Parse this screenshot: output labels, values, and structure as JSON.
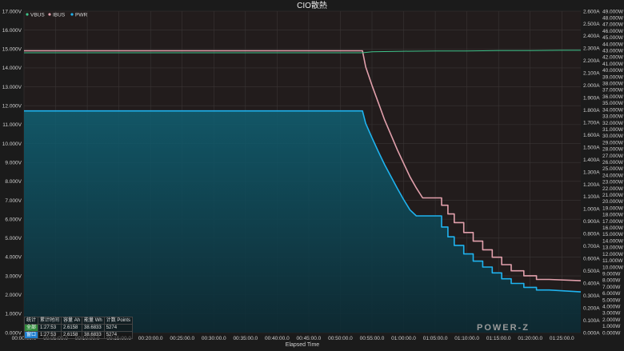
{
  "chart_data": {
    "type": "line",
    "title": "CIO散熱",
    "xlabel": "Elapsed Time",
    "x_ticks": [
      "00:00:00.0",
      "00:05:00.0",
      "00:10:00.0",
      "00:15:00.0",
      "00:20:00.0",
      "00:25:00.0",
      "00:30:00.0",
      "00:35:00.0",
      "00:40:00.0",
      "00:45:00.0",
      "00:50:00.0",
      "00:55:00.0",
      "01:00:00.0",
      "01:05:00.0",
      "01:10:00.0",
      "01:15:00.0",
      "01:20:00.0",
      "01:25:00.0"
    ],
    "x_range_minutes": [
      0,
      88
    ],
    "y_left": {
      "ticks": [
        "0.000V",
        "1.000V",
        "2.000V",
        "3.000V",
        "4.000V",
        "5.000V",
        "6.000V",
        "7.000V",
        "8.000V",
        "9.000V",
        "10.000V",
        "11.000V",
        "12.000V",
        "13.000V",
        "14.000V",
        "15.000V",
        "16.000V",
        "17.000V"
      ],
      "range": [
        0,
        17
      ]
    },
    "y_right_current": {
      "ticks": [
        "0.000A",
        "0.100A",
        "0.200A",
        "0.300A",
        "0.400A",
        "0.500A",
        "0.600A",
        "0.700A",
        "0.800A",
        "0.900A",
        "1.000A",
        "1.100A",
        "1.200A",
        "1.300A",
        "1.400A",
        "1.500A",
        "1.600A",
        "1.700A",
        "1.800A",
        "1.900A",
        "2.000A",
        "2.100A",
        "2.200A",
        "2.300A",
        "2.400A",
        "2.500A",
        "2.600A"
      ],
      "range": [
        0,
        2.6
      ]
    },
    "y_right_power": {
      "ticks": [
        "0.000W",
        "1.000W",
        "2.000W",
        "3.000W",
        "4.000W",
        "5.000W",
        "6.000W",
        "7.000W",
        "8.000W",
        "9.000W",
        "10.000W",
        "11.000W",
        "12.000W",
        "13.000W",
        "14.000W",
        "15.000W",
        "16.000W",
        "17.000W",
        "18.000W",
        "19.000W",
        "20.000W",
        "21.000W",
        "22.000W",
        "23.000W",
        "24.000W",
        "25.000W",
        "26.000W",
        "27.000W",
        "28.000W",
        "29.000W",
        "30.000W",
        "31.000W",
        "32.000W",
        "33.000W",
        "34.000W",
        "35.000W",
        "36.000W",
        "37.000W",
        "38.000W",
        "39.000W",
        "40.000W",
        "41.000W",
        "42.000W",
        "43.000W",
        "44.000W",
        "45.000W",
        "46.000W",
        "47.000W",
        "48.000W",
        "49.000W"
      ],
      "range": [
        0,
        49
      ]
    },
    "series": [
      {
        "name": "VBUS",
        "color": "#3ec28a",
        "axis": "left",
        "x": [
          0,
          53.5,
          55,
          60,
          65,
          70,
          75,
          80,
          85,
          88
        ],
        "y": [
          14.8,
          14.8,
          14.85,
          14.88,
          14.9,
          14.9,
          14.92,
          14.92,
          14.93,
          14.93
        ]
      },
      {
        "name": "IBUS",
        "color": "#e2a0ac",
        "axis": "right_current",
        "x": [
          0,
          53.5,
          54,
          55,
          56,
          57,
          58,
          59,
          60,
          61,
          62,
          63,
          64.5,
          66,
          66,
          67,
          67,
          68,
          68,
          69.5,
          69.5,
          71,
          71,
          72.5,
          72.5,
          74,
          74,
          75.5,
          75.5,
          77,
          77,
          79,
          79,
          81,
          81,
          83,
          88
        ],
        "y": [
          2.28,
          2.28,
          2.15,
          2.0,
          1.86,
          1.72,
          1.6,
          1.48,
          1.37,
          1.26,
          1.17,
          1.09,
          1.09,
          1.09,
          1.03,
          1.03,
          0.96,
          0.96,
          0.89,
          0.89,
          0.81,
          0.81,
          0.74,
          0.74,
          0.67,
          0.67,
          0.61,
          0.61,
          0.55,
          0.55,
          0.5,
          0.5,
          0.46,
          0.46,
          0.43,
          0.43,
          0.42
        ]
      },
      {
        "name": "PWR",
        "color": "#1fb3ef",
        "axis": "right_power",
        "fill": true,
        "x": [
          0,
          53.5,
          54,
          55,
          56,
          57,
          58,
          59,
          60,
          61,
          62,
          63,
          64.5,
          66,
          66,
          67,
          67,
          68,
          68,
          69.5,
          69.5,
          71,
          71,
          72.5,
          72.5,
          74,
          74,
          75.5,
          75.5,
          77,
          77,
          79,
          79,
          81,
          81,
          83,
          88
        ],
        "y": [
          33.8,
          33.8,
          31.9,
          29.7,
          27.6,
          25.6,
          23.8,
          22.0,
          20.3,
          18.7,
          17.8,
          17.8,
          17.8,
          17.8,
          16.1,
          16.1,
          14.6,
          14.6,
          13.3,
          13.3,
          12.0,
          12.0,
          10.9,
          10.9,
          10.0,
          10.0,
          9.1,
          9.1,
          8.2,
          8.2,
          7.5,
          7.5,
          6.9,
          6.9,
          6.5,
          6.5,
          6.2
        ]
      }
    ],
    "legend_position": "top-left",
    "grid": true
  },
  "stats": {
    "headers": [
      "统计",
      "累计时间",
      "容量 Ah",
      "能量 Wh",
      "计数 Points"
    ],
    "rows": [
      [
        "全部",
        "1:27:53",
        "2.6158",
        "38.6833",
        "5274"
      ],
      [
        "窗口",
        "1:27:53",
        "2.6158",
        "38.6833",
        "5274"
      ]
    ]
  },
  "brand": "POWER-Z",
  "colors": {
    "background": "#1b1b1b",
    "plot_bg": "#221c1c",
    "grid": "#3a3a3a",
    "fill_top": "#0f5466",
    "fill_bottom": "#0d2e36"
  }
}
